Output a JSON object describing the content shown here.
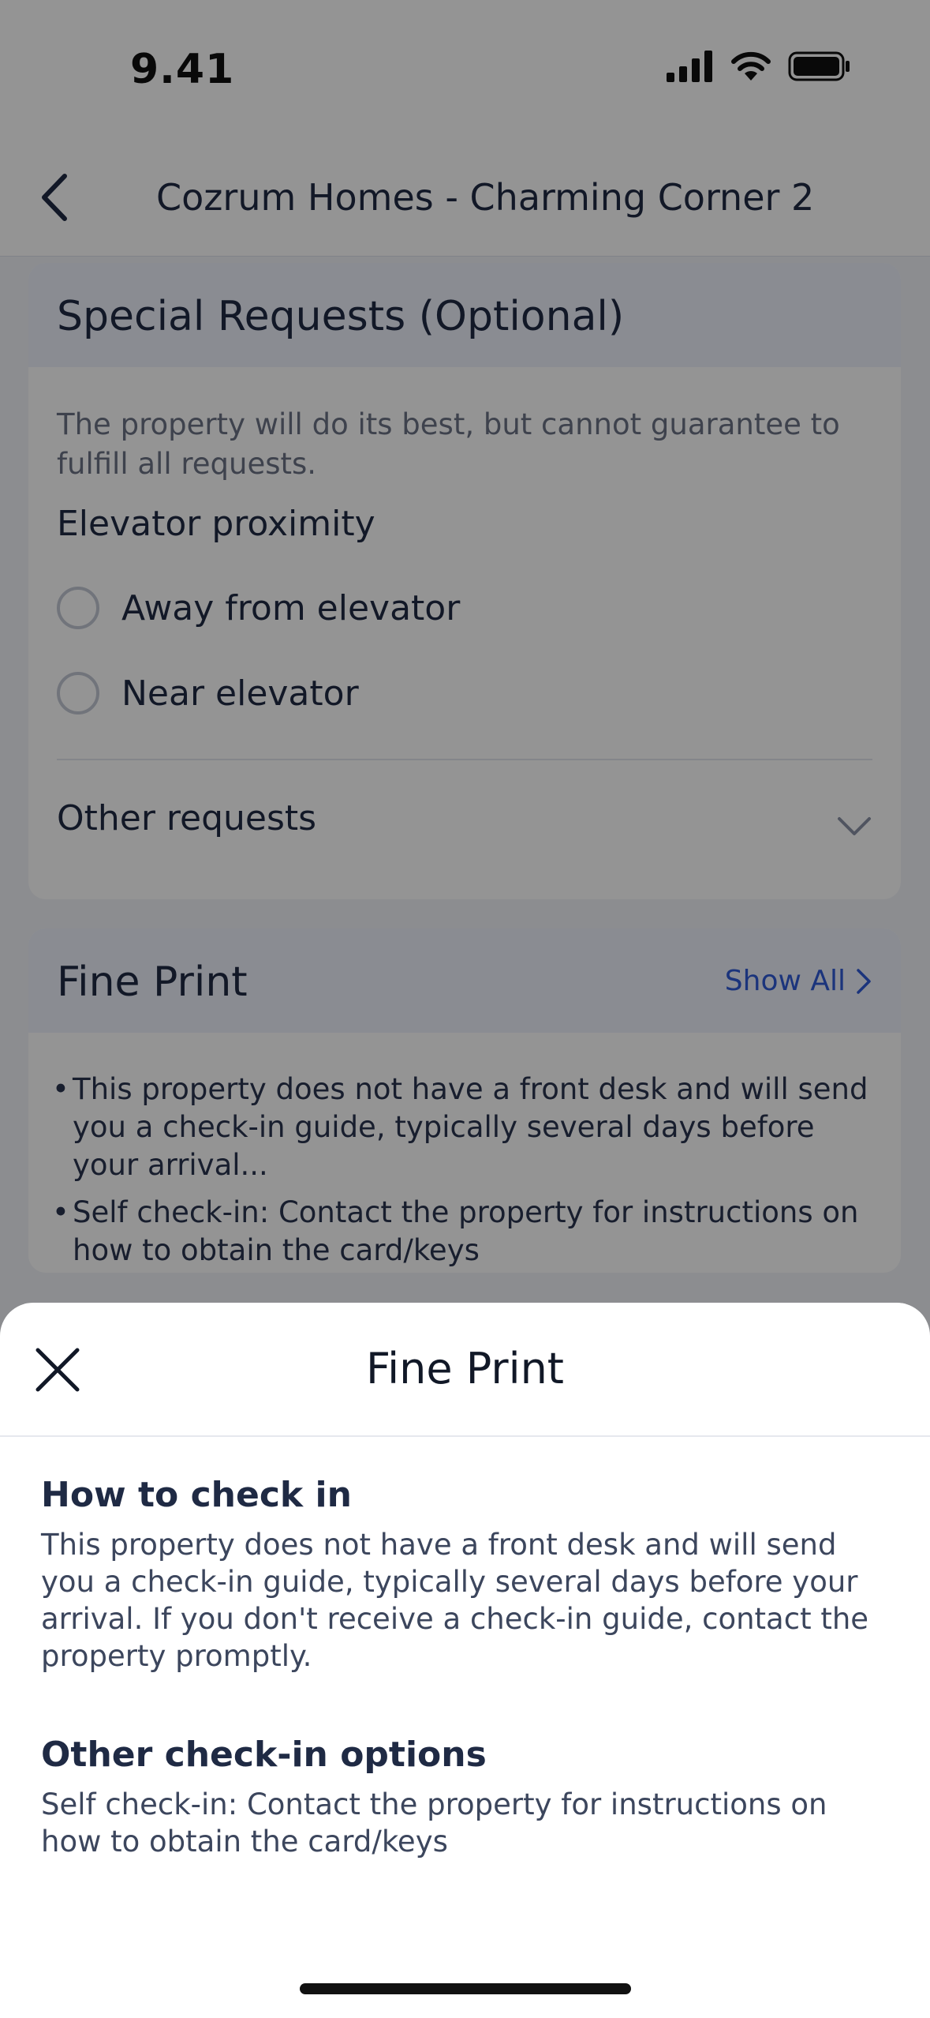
{
  "status_bar": {
    "time": "9.41"
  },
  "nav": {
    "title": "Cozrum Homes - Charming Corner 2"
  },
  "special_requests": {
    "title": "Special Requests (Optional)",
    "description": "The property will do its best, but cannot guarantee to fulfill all requests.",
    "group_title": "Elevator proximity",
    "options": [
      "Away from elevator",
      "Near elevator"
    ],
    "other_requests": "Other requests"
  },
  "fine_print_card": {
    "title": "Fine Print",
    "show_all": "Show All",
    "bullets": [
      "This property does not have a front desk and will send you a check-in guide, typically several days before your arrival...",
      "Self check-in: Contact the property for instructions on how to obtain the card/keys"
    ]
  },
  "sheet": {
    "title": "Fine Print",
    "sections": [
      {
        "title": "How to check in",
        "text": "This property does not have a front desk and will send you a check-in guide, typically several days before your arrival. If you don't receive a check-in guide, contact the property promptly."
      },
      {
        "title": "Other check-in options",
        "text": "Self check-in: Contact the property for instructions on how to obtain the card/keys"
      }
    ]
  },
  "colors": {
    "accent": "#2f5ad6",
    "text": "#1f2a44",
    "overlay": "rgba(0,0,0,0.42)"
  }
}
